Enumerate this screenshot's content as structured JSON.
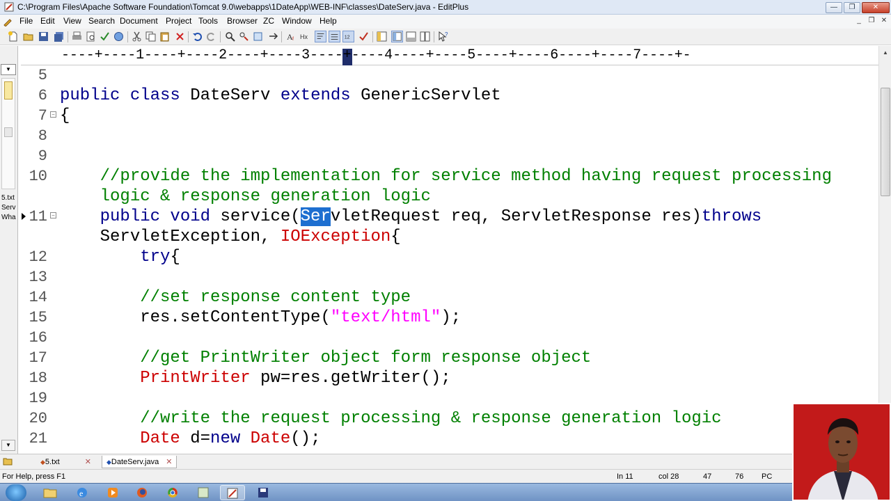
{
  "window": {
    "title": "C:\\Program Files\\Apache Software Foundation\\Tomcat 9.0\\webapps\\1DateApp\\WEB-INF\\classes\\DateServ.java - EditPlus",
    "controls": {
      "minimize": "—",
      "maximize": "❐",
      "close": "✕"
    }
  },
  "menu": {
    "items": [
      "File",
      "Edit",
      "View",
      "Search",
      "Document",
      "Project",
      "Tools",
      "Browser",
      "ZC",
      "Window",
      "Help"
    ],
    "mdi": {
      "minimize": "_",
      "restore": "❐",
      "close": "✕"
    }
  },
  "ruler": {
    "text": "----+----1----+----2----+----3----+----4----+----5----+----6----+----7----+-"
  },
  "left_panel": {
    "files": [
      "5.txt",
      "Serv",
      "Wha"
    ]
  },
  "editor": {
    "lines": [
      {
        "num": "5",
        "fold": "",
        "parts": []
      },
      {
        "num": "6",
        "fold": "",
        "parts": [
          {
            "t": "public class ",
            "c": "kw"
          },
          {
            "t": "DateServ ",
            "c": ""
          },
          {
            "t": "extends ",
            "c": "kw"
          },
          {
            "t": "GenericServlet",
            "c": ""
          }
        ]
      },
      {
        "num": "7",
        "fold": "⊟",
        "parts": [
          {
            "t": "{",
            "c": ""
          }
        ]
      },
      {
        "num": "8",
        "fold": "",
        "parts": []
      },
      {
        "num": "9",
        "fold": "",
        "parts": []
      },
      {
        "num": "10",
        "fold": "",
        "parts": [
          {
            "t": "    //provide the implementation for service method having request processing",
            "c": "cm"
          }
        ]
      },
      {
        "num": "",
        "fold": "",
        "parts": [
          {
            "t": "    logic & response generation logic",
            "c": "cm"
          }
        ]
      },
      {
        "num": "11",
        "fold": "⊟",
        "bookmark": true,
        "parts": [
          {
            "t": "    public void ",
            "c": "kw"
          },
          {
            "t": "service(",
            "c": ""
          },
          {
            "t": "Ser",
            "c": "sel"
          },
          {
            "t": "vletRequest req, ServletResponse res)",
            "c": ""
          },
          {
            "t": "throws",
            "c": "kw"
          }
        ]
      },
      {
        "num": "",
        "fold": "",
        "parts": [
          {
            "t": "    ServletException, ",
            "c": ""
          },
          {
            "t": "IOException",
            "c": "ty"
          },
          {
            "t": "{",
            "c": ""
          }
        ]
      },
      {
        "num": "12",
        "fold": "",
        "parts": [
          {
            "t": "        try",
            "c": "kw"
          },
          {
            "t": "{",
            "c": ""
          }
        ]
      },
      {
        "num": "13",
        "fold": "",
        "parts": []
      },
      {
        "num": "14",
        "fold": "",
        "parts": [
          {
            "t": "        //set response content type",
            "c": "cm"
          }
        ]
      },
      {
        "num": "15",
        "fold": "",
        "parts": [
          {
            "t": "        res.setContentType(",
            "c": ""
          },
          {
            "t": "\"text/html\"",
            "c": "st"
          },
          {
            "t": ");",
            "c": ""
          }
        ]
      },
      {
        "num": "16",
        "fold": "",
        "parts": []
      },
      {
        "num": "17",
        "fold": "",
        "parts": [
          {
            "t": "        //get PrintWriter object form response object",
            "c": "cm"
          }
        ]
      },
      {
        "num": "18",
        "fold": "",
        "parts": [
          {
            "t": "        PrintWriter ",
            "c": "ty"
          },
          {
            "t": "pw=res.getWriter();",
            "c": ""
          }
        ]
      },
      {
        "num": "19",
        "fold": "",
        "parts": []
      },
      {
        "num": "20",
        "fold": "",
        "parts": [
          {
            "t": "        //write the request processing & response generation logic",
            "c": "cm"
          }
        ]
      },
      {
        "num": "21",
        "fold": "",
        "parts": [
          {
            "t": "        Date ",
            "c": "ty"
          },
          {
            "t": "d=",
            "c": ""
          },
          {
            "t": "new ",
            "c": "kw"
          },
          {
            "t": "Date",
            "c": "ty"
          },
          {
            "t": "();",
            "c": ""
          }
        ]
      }
    ]
  },
  "tabs": [
    {
      "label": "5.txt",
      "active": false
    },
    {
      "label": "DateServ.java",
      "active": true
    }
  ],
  "status": {
    "help": "For Help, press F1",
    "line": "In 11",
    "col": "col 28",
    "count1": "47",
    "count2": "76",
    "mode": "PC"
  },
  "colors": {
    "keyword": "#00008b",
    "comment": "#008000",
    "string": "#ff00ff",
    "type": "#cc0000",
    "selection": "#1e6fd0"
  }
}
